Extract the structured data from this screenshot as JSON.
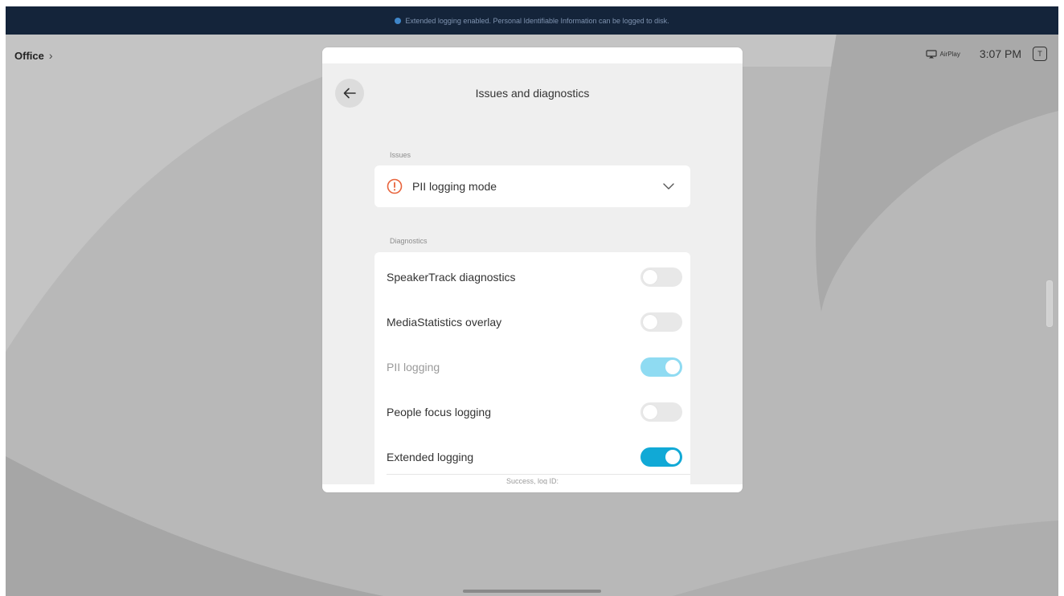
{
  "banner": {
    "message": "Extended logging enabled. Personal Identifiable Information can be logged to disk."
  },
  "topbar": {
    "location": "Office",
    "airplay_label": "AirPlay",
    "time": "3:07 PM",
    "badge": "T"
  },
  "panel": {
    "title": "Issues and diagnostics",
    "issues_section_label": "Issues",
    "issue_item": {
      "label": "PII logging mode",
      "icon": "warning-circle-icon",
      "icon_color": "#e8643c"
    },
    "diagnostics_section_label": "Diagnostics",
    "diagnostics": [
      {
        "label": "SpeakerTrack diagnostics",
        "enabled": false,
        "disabled": false
      },
      {
        "label": "MediaStatistics overlay",
        "enabled": false,
        "disabled": false
      },
      {
        "label": "PII logging",
        "enabled": true,
        "disabled": true
      },
      {
        "label": "People focus logging",
        "enabled": false,
        "disabled": false
      },
      {
        "label": "Extended logging",
        "enabled": true,
        "disabled": false
      }
    ],
    "status_text": "Success, log ID:"
  },
  "colors": {
    "banner_bg": "#14243a",
    "toggle_on": "#11a9d6",
    "toggle_on_disabled": "#8fdbf2",
    "toggle_off": "#e8e8e8"
  }
}
